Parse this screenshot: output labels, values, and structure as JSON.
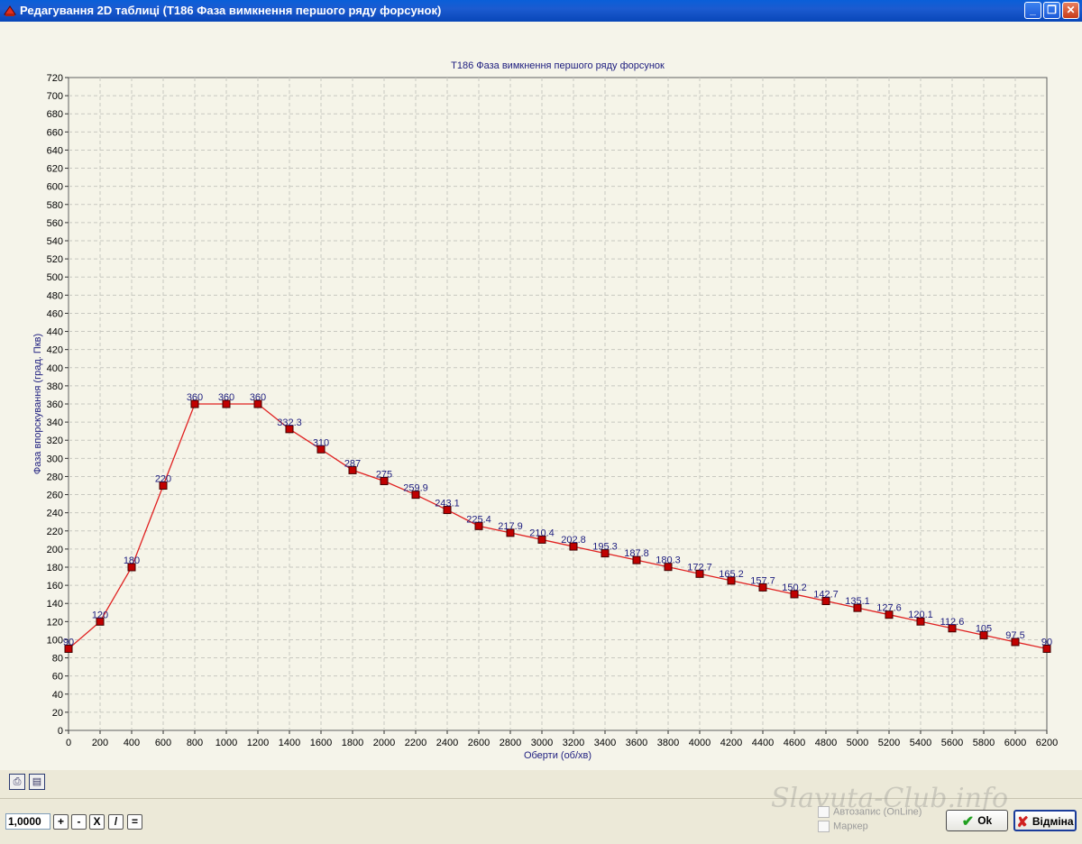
{
  "window": {
    "title": "Редагування 2D таблиці (T186 Фаза вимкнення першого ряду форсунок)",
    "min_label": "_",
    "max_label": "❐",
    "close_label": "✕"
  },
  "chart_data": {
    "type": "line",
    "title": "T186 Фаза вимкнення першого ряду форсунок",
    "xlabel": "Оберти (об/хв)",
    "ylabel": "Фаза впорскування (град. Пкв)",
    "x": [
      0,
      200,
      400,
      600,
      800,
      1000,
      1200,
      1400,
      1600,
      1800,
      2000,
      2200,
      2400,
      2600,
      2800,
      3000,
      3200,
      3400,
      3600,
      3800,
      4000,
      4200,
      4400,
      4600,
      4800,
      5000,
      5200,
      5400,
      5600,
      5800,
      6000,
      6200
    ],
    "values": [
      90,
      120,
      180,
      270,
      360,
      360,
      360,
      332.3,
      310,
      287,
      275,
      259.9,
      243.1,
      225.4,
      217.9,
      210.4,
      202.8,
      195.3,
      187.8,
      180.3,
      172.7,
      165.2,
      157.7,
      150.2,
      142.7,
      135.1,
      127.6,
      120.1,
      112.6,
      105,
      97.5,
      90
    ],
    "value_labels": [
      "90",
      "120",
      "180",
      "220",
      "360",
      "360",
      "360",
      "332.3",
      "310",
      "287",
      "275",
      "259.9",
      "243.1",
      "225.4",
      "217.9",
      "210.4",
      "202.8",
      "195.3",
      "187.8",
      "180.3",
      "172.7",
      "165.2",
      "157.7",
      "150.2",
      "142.7",
      "135.1",
      "127.6",
      "120.1",
      "112.6",
      "105",
      "97.5",
      "90"
    ],
    "xlim": [
      0,
      6200
    ],
    "ylim": [
      0,
      720
    ],
    "x_ticks": [
      "0",
      "200",
      "400",
      "600",
      "800",
      "1000",
      "1200",
      "1400",
      "1600",
      "1800",
      "2000",
      "2200",
      "2400",
      "2600",
      "2800",
      "3000",
      "3200",
      "3400",
      "3600",
      "3800",
      "4000",
      "4200",
      "4400",
      "4600",
      "4800",
      "5000",
      "5200",
      "5400",
      "5600",
      "5800",
      "6000",
      "6200"
    ],
    "y_step": 20,
    "grid": true,
    "line_color": "#e02020",
    "marker_color": "#c00000",
    "label_color": "#202080"
  },
  "toolbar": {
    "value": "1,0000",
    "plus_label": "+",
    "minus_label": "-",
    "multiply_label": "X",
    "divide_label": "/",
    "equals_label": "="
  },
  "options": {
    "autosave_label": "Автозапис (OnLine)",
    "marker_label": "Маркер"
  },
  "buttons": {
    "ok_label": "Ok",
    "cancel_label": "Відміна"
  },
  "watermark": "Slavuta-Club.info"
}
